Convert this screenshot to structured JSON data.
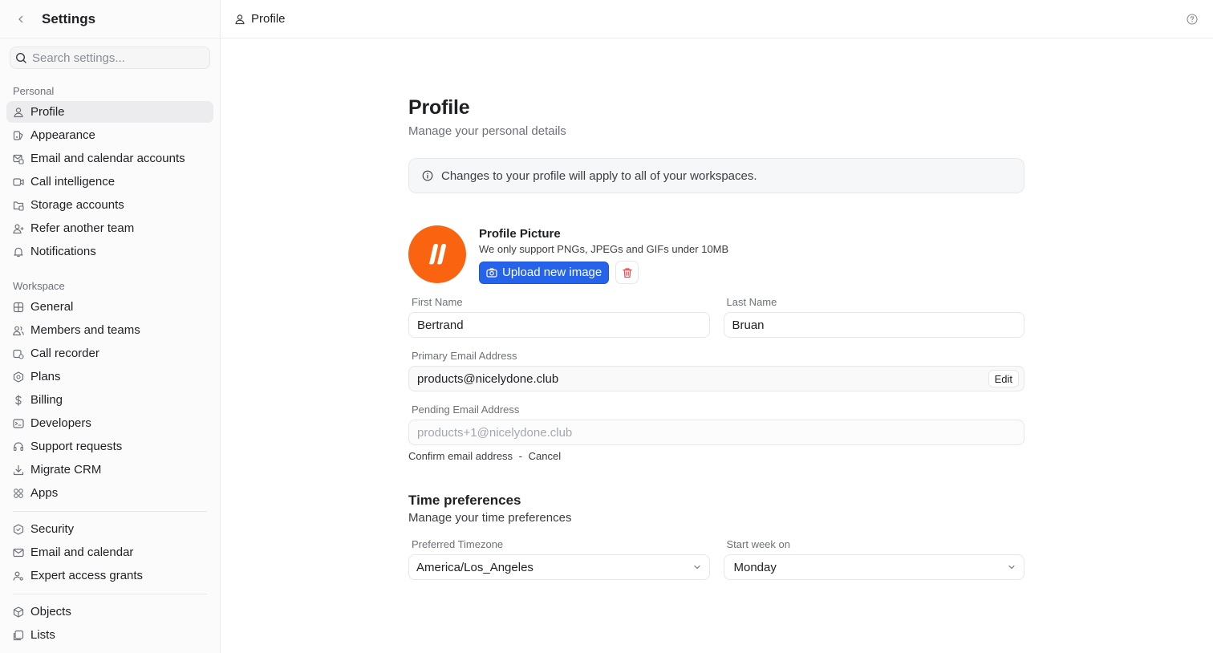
{
  "sidebar": {
    "title": "Settings",
    "search_placeholder": "Search settings...",
    "personal_label": "Personal",
    "personal_items": [
      {
        "label": "Profile",
        "icon": "user-icon"
      },
      {
        "label": "Appearance",
        "icon": "appearance-icon"
      },
      {
        "label": "Email and calendar accounts",
        "icon": "mail-calendar-icon"
      },
      {
        "label": "Call intelligence",
        "icon": "video-icon"
      },
      {
        "label": "Storage accounts",
        "icon": "storage-icon"
      },
      {
        "label": "Refer another team",
        "icon": "user-plus-icon"
      },
      {
        "label": "Notifications",
        "icon": "bell-icon"
      }
    ],
    "workspace_label": "Workspace",
    "workspace_items": [
      {
        "label": "General",
        "icon": "grid-icon"
      },
      {
        "label": "Members and teams",
        "icon": "users-icon"
      },
      {
        "label": "Call recorder",
        "icon": "call-recorder-icon"
      },
      {
        "label": "Plans",
        "icon": "plans-icon"
      },
      {
        "label": "Billing",
        "icon": "dollar-icon"
      },
      {
        "label": "Developers",
        "icon": "terminal-icon"
      },
      {
        "label": "Support requests",
        "icon": "headset-icon"
      },
      {
        "label": "Migrate CRM",
        "icon": "download-icon"
      },
      {
        "label": "Apps",
        "icon": "apps-icon"
      }
    ],
    "security_items": [
      {
        "label": "Security",
        "icon": "shield-icon"
      },
      {
        "label": "Email and calendar",
        "icon": "mail-icon"
      },
      {
        "label": "Expert access grants",
        "icon": "user-key-icon"
      }
    ],
    "data_items": [
      {
        "label": "Objects",
        "icon": "cube-icon"
      },
      {
        "label": "Lists",
        "icon": "list-icon"
      }
    ]
  },
  "topbar": {
    "crumb": "Profile"
  },
  "main": {
    "title": "Profile",
    "subtitle": "Manage your personal details",
    "notice": "Changes to your profile will apply to all of your workspaces.",
    "picture": {
      "title": "Profile Picture",
      "desc": "We only support PNGs, JPEGs and GIFs under 10MB",
      "upload_label": "Upload new image"
    },
    "first_name": {
      "label": "First Name",
      "value": "Bertrand"
    },
    "last_name": {
      "label": "Last Name",
      "value": "Bruan"
    },
    "primary_email": {
      "label": "Primary Email Address",
      "value": "products@nicelydone.club",
      "edit_label": "Edit"
    },
    "pending_email": {
      "label": "Pending Email Address",
      "value": "products+1@nicelydone.club"
    },
    "confirm": {
      "confirm_label": "Confirm email address",
      "sep": "-",
      "cancel_label": "Cancel"
    },
    "time": {
      "title": "Time preferences",
      "subtitle": "Manage your time preferences",
      "timezone": {
        "label": "Preferred Timezone",
        "value": "America/Los_Angeles"
      },
      "week_start": {
        "label": "Start week on",
        "value": "Monday"
      }
    }
  },
  "colors": {
    "accent": "#2563eb",
    "avatar": "#fa6410",
    "danger": "#e5484d"
  }
}
